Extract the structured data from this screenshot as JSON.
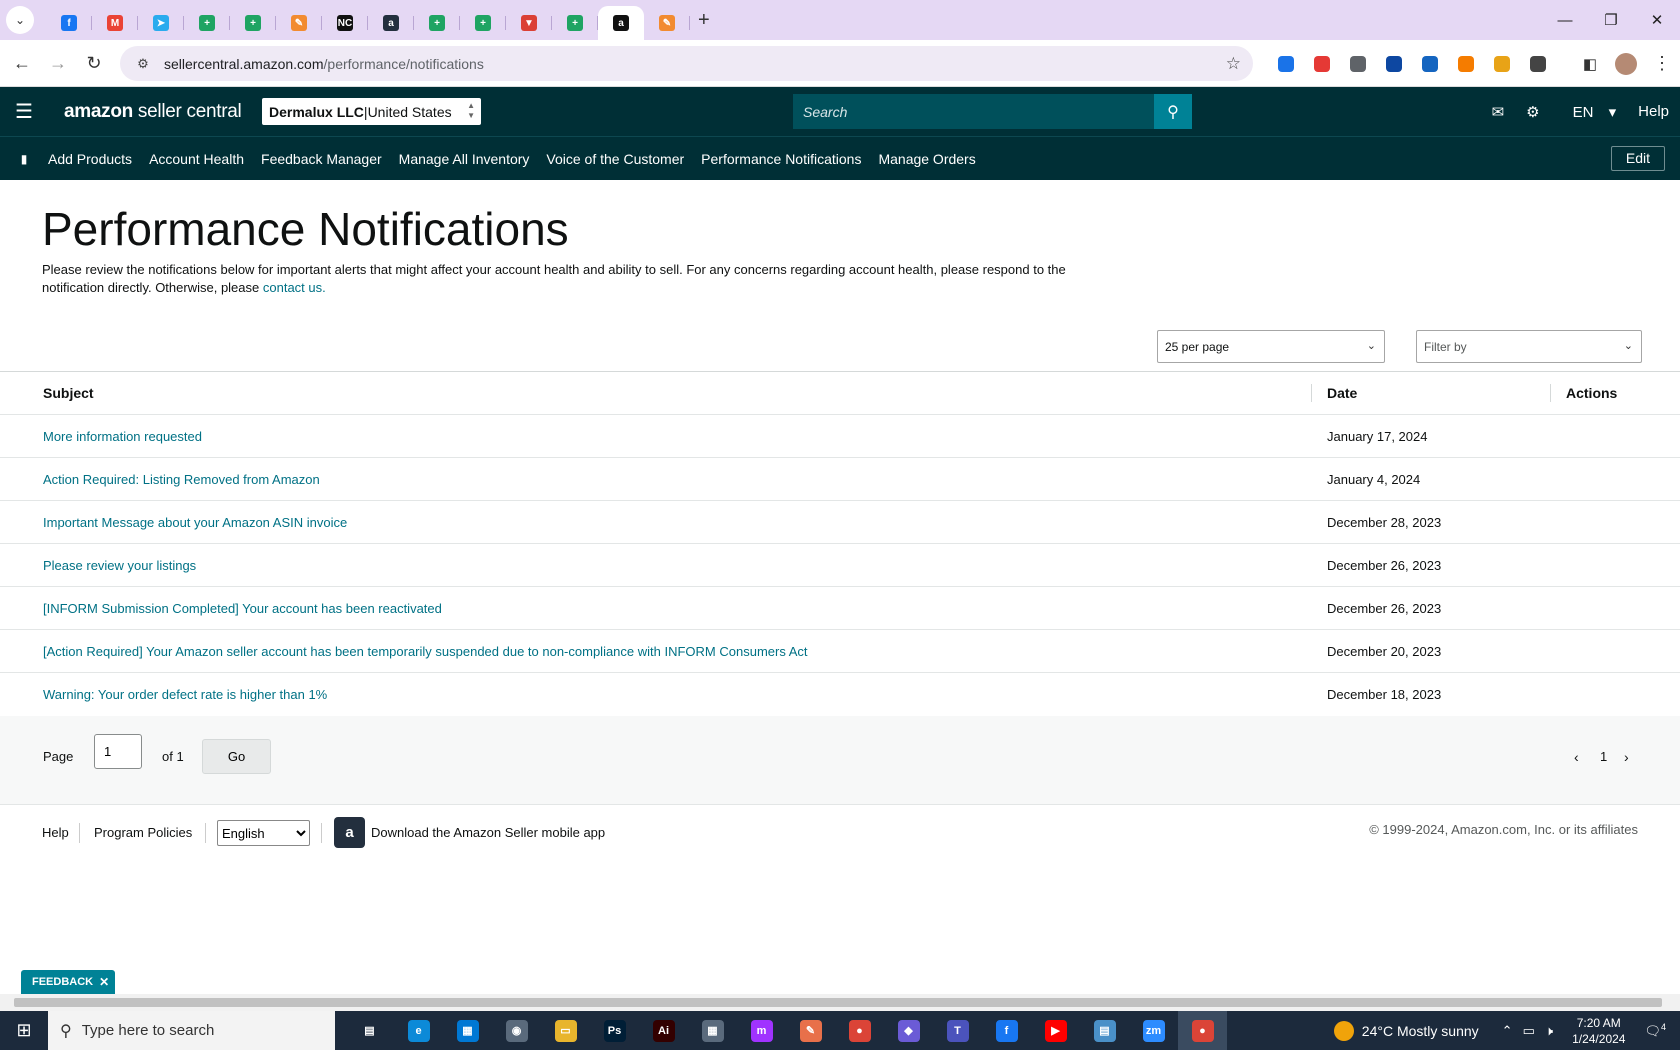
{
  "browser": {
    "tabs": [
      {
        "name": "facebook",
        "color": "#1877f2",
        "glyph": "f"
      },
      {
        "name": "gmail",
        "color": "#ea4335",
        "glyph": "M"
      },
      {
        "name": "telegram",
        "color": "#2aabee",
        "glyph": "➤"
      },
      {
        "name": "sheets-1",
        "color": "#1fa463",
        "glyph": "+"
      },
      {
        "name": "sheets-2",
        "color": "#1fa463",
        "glyph": "+"
      },
      {
        "name": "app-pencil-1",
        "color": "#f28b30",
        "glyph": "✎"
      },
      {
        "name": "nc",
        "color": "#111111",
        "glyph": "NC"
      },
      {
        "name": "amazon-1",
        "color": "#232f3e",
        "glyph": "a"
      },
      {
        "name": "sheets-3",
        "color": "#1fa463",
        "glyph": "+"
      },
      {
        "name": "sheets-4",
        "color": "#1fa463",
        "glyph": "+"
      },
      {
        "name": "todoist",
        "color": "#db4035",
        "glyph": "▼"
      },
      {
        "name": "sheets-5",
        "color": "#1fa463",
        "glyph": "+"
      },
      {
        "name": "amazon-active",
        "color": "#111111",
        "glyph": "a",
        "active": true
      },
      {
        "name": "app-pencil-2",
        "color": "#f28b30",
        "glyph": "✎"
      }
    ],
    "url_host": "sellercentral.amazon.com",
    "url_path": "/performance/notifications",
    "extensions": [
      "#1a73e8",
      "#e53935",
      "#5f6368",
      "#0d47a1",
      "#1565c0",
      "#f57c00",
      "#e8a317",
      "#444444"
    ]
  },
  "header": {
    "logo_strong": "amazon",
    "logo_rest": " seller central",
    "account_name": "Dermalux LLC",
    "account_sep": " | ",
    "account_region": "United States",
    "search_placeholder": "Search",
    "language": "EN",
    "help": "Help"
  },
  "nav": {
    "items": [
      "Add Products",
      "Account Health",
      "Feedback Manager",
      "Manage All Inventory",
      "Voice of the Customer",
      "Performance Notifications",
      "Manage Orders"
    ],
    "edit": "Edit"
  },
  "page": {
    "title": "Performance Notifications",
    "intro_text": "Please review the notifications below for important alerts that might affect your account health and ability to sell. For any concerns regarding account health, please respond to the notification directly. Otherwise, please ",
    "intro_link": "contact us."
  },
  "controls": {
    "per_page": "25 per page",
    "filter": "Filter by"
  },
  "table": {
    "headers": {
      "subject": "Subject",
      "date": "Date",
      "actions": "Actions"
    },
    "rows": [
      {
        "subject": "More information requested",
        "date": "January 17, 2024"
      },
      {
        "subject": "Action Required: Listing Removed from Amazon",
        "date": "January 4, 2024"
      },
      {
        "subject": "Important Message about your Amazon ASIN invoice",
        "date": "December 28, 2023"
      },
      {
        "subject": "Please review your listings",
        "date": "December 26, 2023"
      },
      {
        "subject": "[INFORM Submission Completed] Your account has been reactivated",
        "date": "December 26, 2023"
      },
      {
        "subject": "[Action Required] Your Amazon seller account has been temporarily suspended due to non-compliance with INFORM Consumers Act",
        "date": "December 20, 2023"
      },
      {
        "subject": "Warning: Your order defect rate is higher than 1%",
        "date": "December 18, 2023"
      }
    ]
  },
  "pagination": {
    "page_label": "Page",
    "page_value": "1",
    "of_label": "of 1",
    "go": "Go",
    "current": "1"
  },
  "footer": {
    "help": "Help",
    "policies": "Program Policies",
    "language": "English",
    "app_text": "Download the Amazon Seller mobile app",
    "copyright": "© 1999-2024, Amazon.com, Inc. or its affiliates"
  },
  "feedback": "FEEDBACK",
  "taskbar": {
    "search_placeholder": "Type here to search",
    "apps": [
      {
        "name": "task-view",
        "color": "#1c2a3c",
        "glyph": "▤"
      },
      {
        "name": "edge",
        "color": "#0c8ad8",
        "glyph": "e"
      },
      {
        "name": "store",
        "color": "#0078d4",
        "glyph": "▦"
      },
      {
        "name": "camera",
        "color": "#5a6a7c",
        "glyph": "◉"
      },
      {
        "name": "file-explorer",
        "color": "#e8b52d",
        "glyph": "▭"
      },
      {
        "name": "photoshop",
        "color": "#001e36",
        "glyph": "Ps"
      },
      {
        "name": "illustrator",
        "color": "#330000",
        "glyph": "Ai"
      },
      {
        "name": "calculator",
        "color": "#5a6a7c",
        "glyph": "▦"
      },
      {
        "name": "messenger",
        "color": "#a033ff",
        "glyph": "m"
      },
      {
        "name": "pen-app",
        "color": "#e8704a",
        "glyph": "✎"
      },
      {
        "name": "chrome",
        "color": "#db4437",
        "glyph": "●"
      },
      {
        "name": "diamond-app",
        "color": "#6b5bd6",
        "glyph": "◆"
      },
      {
        "name": "teams",
        "color": "#4b53bc",
        "glyph": "T"
      },
      {
        "name": "facebook",
        "color": "#1877f2",
        "glyph": "f"
      },
      {
        "name": "youtube",
        "color": "#ff0000",
        "glyph": "▶"
      },
      {
        "name": "notepad",
        "color": "#4a90c8",
        "glyph": "▤"
      },
      {
        "name": "zoom",
        "color": "#2d8cff",
        "glyph": "zm"
      },
      {
        "name": "chrome-active",
        "color": "#db4437",
        "glyph": "●",
        "active": true
      }
    ],
    "weather": "24°C  Mostly sunny",
    "time": "7:20 AM",
    "date": "1/24/2024",
    "notifications": "4"
  }
}
